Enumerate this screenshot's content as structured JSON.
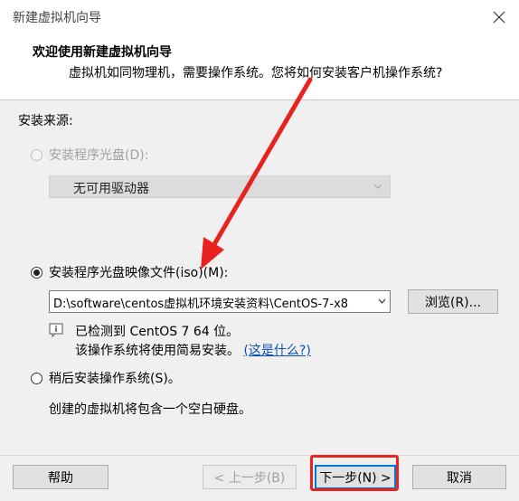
{
  "window": {
    "title": "新建虚拟机向导"
  },
  "header": {
    "title": "欢迎使用新建虚拟机向导",
    "subtitle": "虚拟机如同物理机，需要操作系统。您将如何安装客户机操作系统?"
  },
  "install_source": {
    "label": "安装来源:",
    "option_disc": {
      "label": "安装程序光盘(D):",
      "selected": false,
      "enabled": false,
      "drive_value": "无可用驱动器"
    },
    "option_iso": {
      "label": "安装程序光盘映像文件(iso)(M):",
      "selected": true,
      "path_value": "D:\\software\\centos虚拟机环境安装资料\\CentOS-7-x8",
      "browse_label": "浏览(R)...",
      "detected_text": "已检测到 CentOS 7 64 位。",
      "easy_install_text": "该操作系统将使用简易安装。",
      "whats_this_link": "(这是什么?)"
    },
    "option_later": {
      "label": "稍后安装操作系统(S)。",
      "selected": false,
      "description": "创建的虚拟机将包含一个空白硬盘。"
    }
  },
  "footer": {
    "help_label": "帮助",
    "back_label": "< 上一步(B)",
    "next_label": "下一步(N) >",
    "cancel_label": "取消"
  },
  "colors": {
    "annotation_red": "#e8231f",
    "focus_blue": "#0078d7",
    "link_blue": "#0b4fb4"
  }
}
